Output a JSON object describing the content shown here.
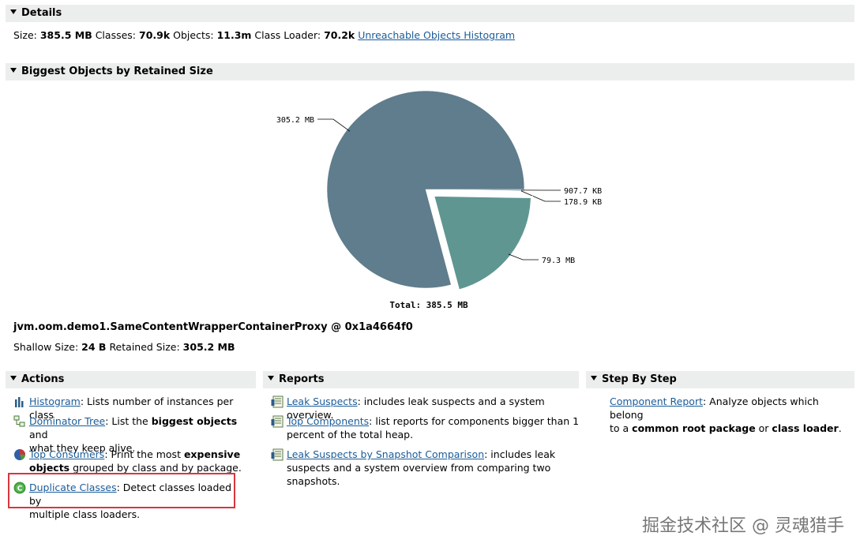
{
  "details": {
    "header": "Details",
    "size_label": "Size:",
    "size_value": "385.5 MB",
    "classes_label": "Classes:",
    "classes_value": "70.9k",
    "objects_label": "Objects:",
    "objects_value": "11.3m",
    "classloader_label": "Class Loader:",
    "classloader_value": "70.2k",
    "unreachable_link": "Unreachable Objects Histogram"
  },
  "biggest": {
    "header": "Biggest Objects by Retained Size",
    "object_name": "jvm.oom.demo1.SameContentWrapperContainerProxy @ 0x1a4664f0",
    "shallow_label": "Shallow Size:",
    "shallow_value": "24 B",
    "retained_label": "Retained Size:",
    "retained_value": "305.2 MB"
  },
  "chart_data": {
    "type": "pie",
    "unit": "MB",
    "total_label": "Total: 385.5 MB",
    "slices": [
      {
        "label": "305.2 MB",
        "value": 305.2,
        "color": "#5f7d8c"
      },
      {
        "label": "907.7 KB",
        "value": 0.8864,
        "color": "#7a9aa6"
      },
      {
        "label": "178.9 KB",
        "value": 0.1747,
        "color": "#6f97a0"
      },
      {
        "label": "79.3 MB",
        "value": 79.3,
        "color": "#5f9691"
      }
    ]
  },
  "actions": {
    "header": "Actions",
    "items": [
      {
        "link": "Histogram",
        "text": ": Lists number of instances per class",
        "icon": "histogram-icon"
      },
      {
        "link": "Dominator Tree",
        "text_pre": ": List the ",
        "bold": "biggest objects",
        "text_post": " and",
        "line2": "what they keep alive.",
        "icon": "dominator-tree-icon"
      },
      {
        "link": "Top Consumers",
        "text_pre": ": Print the most ",
        "bold": "expensive",
        "line2_bold": "objects",
        "line2": " grouped by class and by package.",
        "icon": "top-consumers-icon"
      },
      {
        "link": "Duplicate Classes",
        "text": ": Detect classes loaded by",
        "line2": "multiple class loaders.",
        "icon": "duplicate-classes-icon"
      }
    ]
  },
  "reports": {
    "header": "Reports",
    "items": [
      {
        "link": "Leak Suspects",
        "text": ": includes leak suspects and a system overview.",
        "icon": "report-icon"
      },
      {
        "link": "Top Components",
        "text": ": list reports for components bigger than 1",
        "line2": "percent of the total heap.",
        "icon": "report-icon"
      },
      {
        "link": "Leak Suspects by Snapshot Comparison",
        "text": ": includes leak",
        "line2": "suspects and a system overview from comparing two",
        "line3": "snapshots.",
        "icon": "report-icon"
      }
    ]
  },
  "step": {
    "header": "Step By Step",
    "link": "Component Report",
    "text": ": Analyze objects which belong",
    "line2_pre": "to a ",
    "bold1": "common root package",
    "mid": " or ",
    "bold2": "class loader",
    "end": "."
  },
  "watermark": "掘金技术社区 @ 灵魂猎手"
}
